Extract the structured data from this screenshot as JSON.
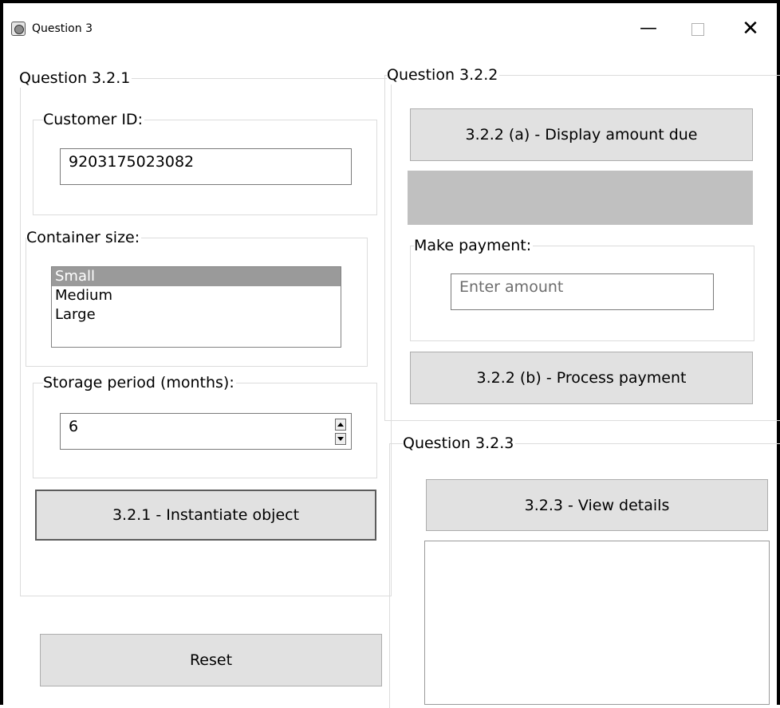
{
  "window": {
    "title": "Question 3",
    "minimize": "—",
    "close": "✕",
    "icon": "app-icon"
  },
  "q321": {
    "legend": "Question 3.2.1",
    "customer_id": {
      "label": "Customer ID:",
      "value": "9203175023082"
    },
    "container": {
      "label": "Container size:",
      "options": [
        "Small",
        "Medium",
        "Large"
      ],
      "selected": "Small"
    },
    "storage": {
      "label": "Storage period (months):",
      "value": "6"
    },
    "instantiate_button": "3.2.1 - Instantiate object"
  },
  "reset_button": "Reset",
  "q322": {
    "legend": "Question 3.2.2",
    "display_button": "3.2.2 (a) - Display amount due",
    "payment": {
      "label": "Make payment:",
      "placeholder": "Enter amount"
    },
    "process_button": "3.2.2 (b) - Process payment"
  },
  "q323": {
    "legend": "Question 3.2.3",
    "view_button": "3.2.3 - View details"
  }
}
